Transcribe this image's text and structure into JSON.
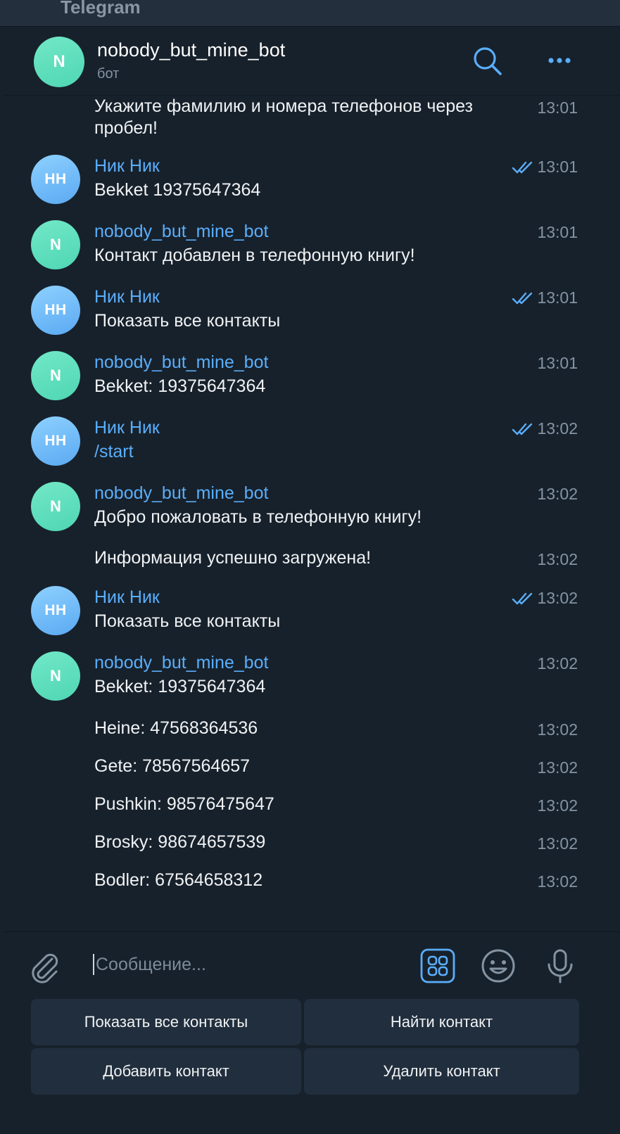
{
  "app": {
    "title": "Telegram"
  },
  "header": {
    "avatar_letter": "N",
    "name": "nobody_but_mine_bot",
    "status": "бот"
  },
  "messages": [
    {
      "text": "Укажите фамилию и номера телефонов через пробел!",
      "time": "13:01"
    },
    {
      "avatar": "НН",
      "sender": "Ник Ник",
      "text": "Bekket 19375647364",
      "time": "13:01",
      "read": true
    },
    {
      "avatar": "N",
      "sender": "nobody_but_mine_bot",
      "text": "Контакт добавлен в телефонную книгу!",
      "time": "13:01"
    },
    {
      "avatar": "НН",
      "sender": "Ник Ник",
      "text": "Показать все контакты",
      "time": "13:01",
      "read": true
    },
    {
      "avatar": "N",
      "sender": "nobody_but_mine_bot",
      "text": "Bekket: 19375647364",
      "time": "13:01"
    },
    {
      "avatar": "НН",
      "sender": "Ник Ник",
      "text": "/start",
      "time": "13:02",
      "read": true
    },
    {
      "avatar": "N",
      "sender": "nobody_but_mine_bot",
      "text": "Добро пожаловать в телефонную книгу!",
      "time": "13:02"
    },
    {
      "text": "Информация успешно загружена!",
      "time": "13:02"
    },
    {
      "avatar": "НН",
      "sender": "Ник Ник",
      "text": "Показать все контакты",
      "time": "13:02",
      "read": true
    },
    {
      "avatar": "N",
      "sender": "nobody_but_mine_bot",
      "text": "Bekket: 19375647364",
      "time": "13:02"
    },
    {
      "text": "Heine: 47568364536",
      "time": "13:02"
    },
    {
      "text": "Gete: 78567564657",
      "time": "13:02"
    },
    {
      "text": "Pushkin: 98576475647",
      "time": "13:02"
    },
    {
      "text": "Brosky: 98674657539",
      "time": "13:02"
    },
    {
      "text": "Bodler: 67564658312",
      "time": "13:02"
    }
  ],
  "composer": {
    "placeholder": "Сообщение..."
  },
  "keyboard": {
    "show_all": "Показать все контакты",
    "find": "Найти контакт",
    "add": "Добавить контакт",
    "delete": "Удалить контакт"
  },
  "colors": {
    "background": "#17212b",
    "accent": "#5aaefb",
    "button": "#212e3d"
  }
}
